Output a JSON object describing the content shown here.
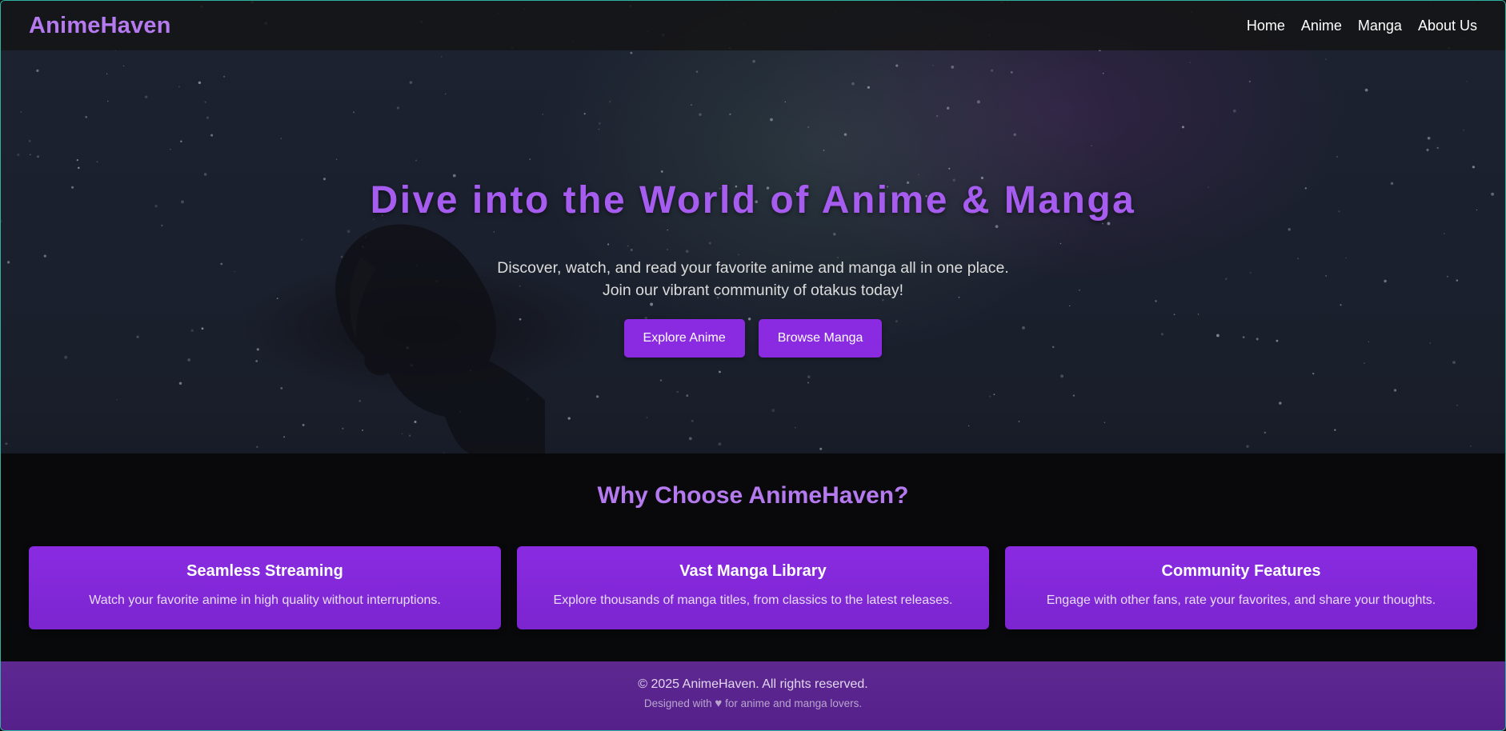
{
  "header": {
    "logo": "AnimeHaven",
    "nav": [
      "Home",
      "Anime",
      "Manga",
      "About Us"
    ]
  },
  "hero": {
    "title": "Dive into the World of Anime & Manga",
    "subtitle_line1": "Discover, watch, and read your favorite anime and manga all in one place.",
    "subtitle_line2": "Join our vibrant community of otakus today!",
    "primary_button": "Explore Anime",
    "secondary_button": "Browse Manga"
  },
  "features": {
    "title": "Why Choose AnimeHaven?",
    "cards": [
      {
        "title": "Seamless Streaming",
        "text": "Watch your favorite anime in high quality without interruptions."
      },
      {
        "title": "Vast Manga Library",
        "text": "Explore thousands of manga titles, from classics to the latest releases."
      },
      {
        "title": "Community Features",
        "text": "Engage with other fans, rate your favorites, and share your thoughts."
      }
    ]
  },
  "footer": {
    "copyright": "© 2025 AnimeHaven. All rights reserved.",
    "made_prefix": "Designed with",
    "heart": "♥",
    "made_suffix": "for anime and manga lovers."
  },
  "colors": {
    "accent": "#8a2be2",
    "title_purple": "#a55cef",
    "logo_purple": "#b57aef",
    "footer_bg": "#5e2891",
    "frame_border": "#2fb3a0"
  }
}
